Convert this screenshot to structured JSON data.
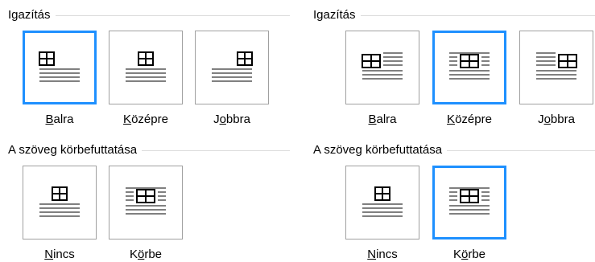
{
  "left": {
    "alignment": {
      "title": "Igazítás",
      "options": [
        {
          "pre": "",
          "acc": "B",
          "post": "alra"
        },
        {
          "pre": "",
          "acc": "K",
          "post": "özépre"
        },
        {
          "pre": "J",
          "acc": "o",
          "post": "bbra"
        }
      ],
      "selected_index": 2
    },
    "wrapping": {
      "title": "A szöveg körbefuttatása",
      "options": [
        {
          "pre": "",
          "acc": "N",
          "post": "incs"
        },
        {
          "pre": "K",
          "acc": "ö",
          "post": "rbe"
        }
      ],
      "selected_index": 0
    }
  },
  "right": {
    "alignment": {
      "title": "Igazítás",
      "options": [
        {
          "pre": "",
          "acc": "B",
          "post": "alra"
        },
        {
          "pre": "",
          "acc": "K",
          "post": "özépre"
        },
        {
          "pre": "J",
          "acc": "o",
          "post": "bbra"
        }
      ],
      "selected_index": 1
    },
    "wrapping": {
      "title": "A szöveg körbefuttatása",
      "options": [
        {
          "pre": "",
          "acc": "N",
          "post": "incs"
        },
        {
          "pre": "K",
          "acc": "ö",
          "post": "rbe"
        }
      ],
      "selected_index": 1
    }
  },
  "colors": {
    "selected_border": "#1e90ff",
    "icon_lines": "#808080",
    "icon_table": "#000000"
  }
}
